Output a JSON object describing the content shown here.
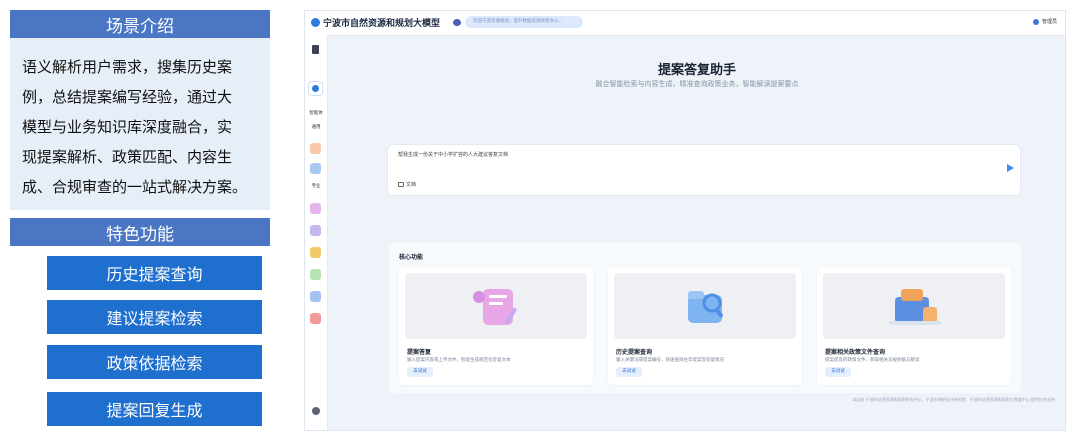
{
  "left_panel": {
    "scene_title": "场景介绍",
    "scene_lines": [
      "语义解析用户需求，搜集历史案",
      "例，总结提案编写经验，通过大",
      "模型与业务知识库深度融合，实",
      "现提案解析、政策匹配、内容生",
      "成、合规审查的一站式解决方案。"
    ],
    "features_title": "特色功能",
    "features": [
      "历史提案查询",
      "建议提案检索",
      "政策依据检索",
      "提案回复生成"
    ]
  },
  "app": {
    "title": "宁波市自然资源和规划大模型",
    "notice": "欢迎宁波资源规划，提升数据资源效率办公...",
    "user_name": "管理员",
    "sidebar": {
      "agent_label": "智能体",
      "general_label": "通用",
      "pro_label": "专业"
    },
    "main_title": "提案答复助手",
    "subtitle": "融合智能检索与内容生成，精准查询政策业务，智能解读提案要点",
    "input_placeholder": "帮我生成一份关于中小学扩容的人大建议答复文档",
    "doc_label": "文档",
    "core_title": "核心功能",
    "cards": [
      {
        "title": "提案答复",
        "desc": "输入提案内容或上传文件，智能生成规范化答复文本",
        "button": "去试试"
      },
      {
        "title": "历史提案查询",
        "desc": "输入关键词或提案编号，快速查阅往年提案及答复情况",
        "button": "去试试"
      },
      {
        "title": "提案相关政策文件查询",
        "desc": "提案提及的政策文件、获取相关法规依据与解读",
        "button": "去试试"
      }
    ],
    "footer": "本站由 宁波市自然资源和规划研究中心、宁波市测绘设计研究院、宁波市自然资源和规划大数据中心 提供技术支持"
  },
  "colors": {
    "section_title_bg": "#4a76c3",
    "feature_button_bg": "#1f6fcf",
    "intro_bg": "#e6eef7",
    "accent_blue": "#2d7be0"
  }
}
